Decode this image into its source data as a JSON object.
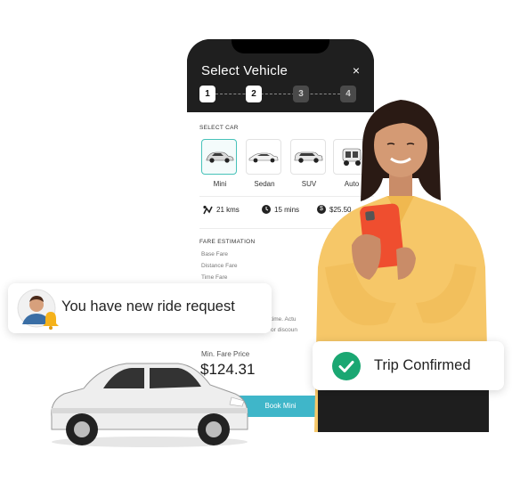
{
  "phone": {
    "title": "Select Vehicle",
    "close_glyph": "×",
    "steps": [
      "1",
      "2",
      "3",
      "4"
    ],
    "select_car_label": "SELECT CAR",
    "cars": [
      {
        "name": "Mini",
        "selected": true
      },
      {
        "name": "Sedan",
        "selected": false
      },
      {
        "name": "SUV",
        "selected": false
      },
      {
        "name": "Auto",
        "selected": false
      }
    ],
    "trip_info": {
      "distance": "21 kms",
      "duration": "15 mins",
      "price": "$25.50",
      "distance_icon": "route-icon",
      "duration_icon": "clock-icon",
      "price_icon": "dollar-icon"
    },
    "fare_estimation": {
      "label": "FARE ESTIMATION",
      "lines": [
        "Base Fare",
        "Distance Fare",
        "Time Fare"
      ],
      "partial_note_1": "time. Actu",
      "partial_note_2": "or discoun"
    },
    "min_fare": {
      "label": "Min. Fare Price",
      "value": "$124.31"
    },
    "book_button": "Book Mini"
  },
  "notification": {
    "text": "You have new ride request",
    "avatar_icon": "driver-avatar",
    "bell_icon": "bell-icon"
  },
  "confirmation": {
    "text": "Trip Confirmed",
    "icon": "check-circle-icon"
  },
  "colors": {
    "accent_teal": "#3fb6c9",
    "selected_border": "#47c2b9",
    "confirm_green": "#1aa772",
    "bell_yellow": "#f5b21b"
  }
}
